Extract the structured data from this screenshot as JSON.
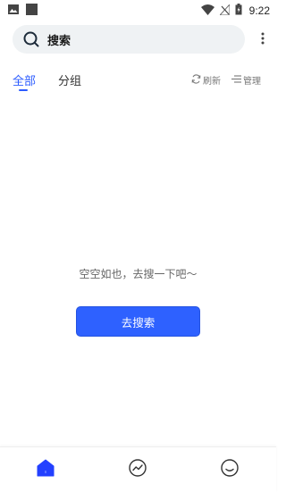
{
  "status_bar": {
    "time": "9:22",
    "icons": [
      "image-notification-icon",
      "square-notification-icon",
      "wifi-icon",
      "no-signal-icon",
      "battery-icon"
    ]
  },
  "search": {
    "label": "搜索",
    "icon": "search-icon"
  },
  "menu": {
    "icon": "more-vertical-icon"
  },
  "tabs": [
    {
      "label": "全部",
      "active": true
    },
    {
      "label": "分组",
      "active": false
    }
  ],
  "actions": {
    "refresh": {
      "label": "刷新",
      "icon": "refresh-icon"
    },
    "manage": {
      "label": "管理",
      "icon": "manage-icon"
    }
  },
  "empty": {
    "message": "空空如也，去搜一下吧～",
    "button_label": "去搜索"
  },
  "bottom_nav": [
    {
      "name": "home",
      "icon": "home-icon",
      "active": true
    },
    {
      "name": "trend",
      "icon": "trend-icon",
      "active": false
    },
    {
      "name": "me",
      "icon": "smile-icon",
      "active": false
    }
  ],
  "colors": {
    "accent": "#2e61ff",
    "search_bg": "#eff2f4",
    "muted_text": "#777777"
  }
}
